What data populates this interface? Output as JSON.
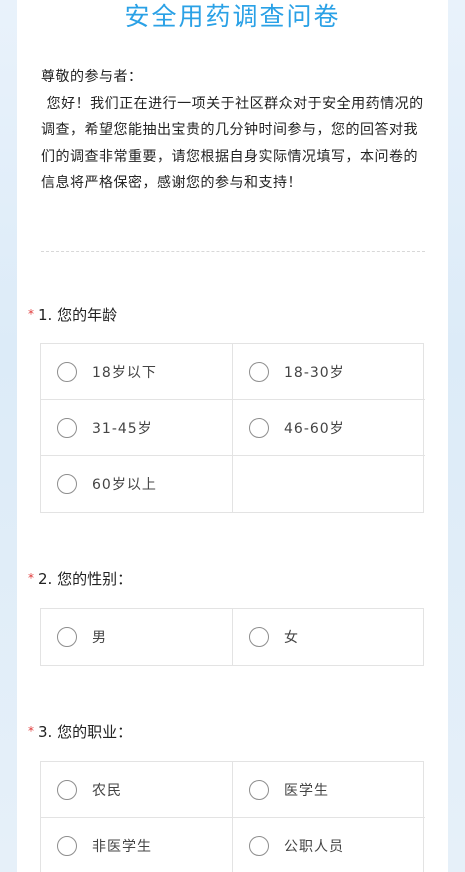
{
  "survey": {
    "title": "安全用药调查问卷",
    "greeting": "尊敬的参与者：",
    "intro": "您好！我们正在进行一项关于社区群众对于安全用药情况的调查，希望您能抽出宝贵的几分钟时间参与，您的回答对我们的调查非常重要，请您根据自身实际情况填写，本问卷的信息将严格保密，感谢您的参与和支持！"
  },
  "questions": [
    {
      "label": "1. 您的年龄",
      "required": true,
      "options": [
        "18岁以下",
        "18-30岁",
        "31-45岁",
        "46-60岁",
        "60岁以上"
      ]
    },
    {
      "label": "2. 您的性别：",
      "required": true,
      "options": [
        "男",
        "女"
      ]
    },
    {
      "label": "3. 您的职业：",
      "required": true,
      "options": [
        "农民",
        "医学生",
        "非医学生",
        "公职人员"
      ]
    }
  ],
  "colors": {
    "title": "#2aa1e6",
    "required_mark": "#e03b3b",
    "page_background": "#dcebf8"
  }
}
